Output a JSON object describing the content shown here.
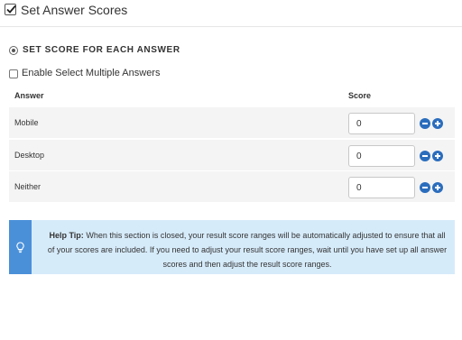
{
  "header": {
    "title": "Set Answer Scores",
    "checked": true
  },
  "scoring": {
    "mode_label": "SET SCORE FOR EACH ANSWER",
    "multiple_label": "Enable Select Multiple Answers",
    "columns": {
      "answer": "Answer",
      "score": "Score"
    },
    "rows": [
      {
        "answer": "Mobile",
        "score": "0"
      },
      {
        "answer": "Desktop",
        "score": "0"
      },
      {
        "answer": "Neither",
        "score": "0"
      }
    ]
  },
  "help_tip": {
    "title": "Help Tip:",
    "text": "When this section is closed, your result score ranges will be automatically adjusted to ensure that all of your scores are included. If you need to adjust your result score ranges, wait until you have set up all answer scores and then adjust the result score ranges."
  },
  "colors": {
    "accent": "#2b6dbd",
    "tip_background": "#d6ebfa",
    "tip_sidebar": "#4a90d9",
    "row_background": "#f4f4f4"
  },
  "icons": [
    "checkbox-checked-icon",
    "radio-selected-icon",
    "minus-circle-icon",
    "plus-circle-icon",
    "lightbulb-icon"
  ]
}
